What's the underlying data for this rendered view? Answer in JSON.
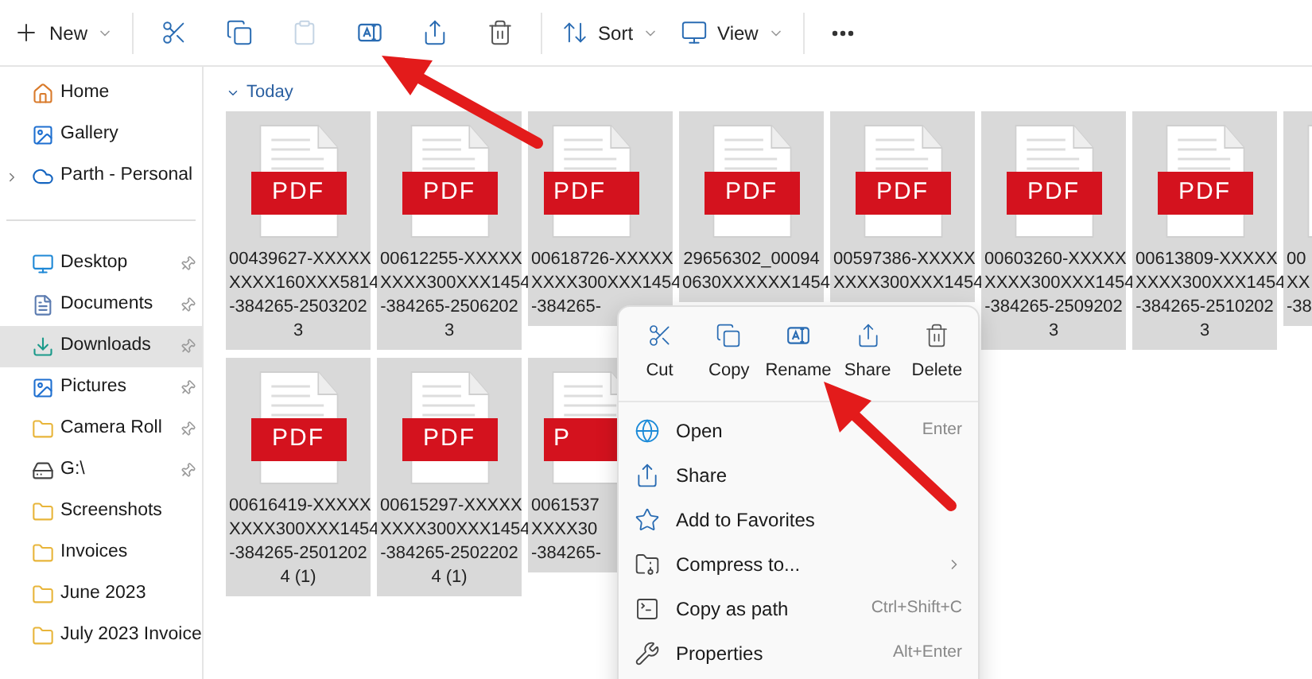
{
  "toolbar": {
    "groups": [
      [
        {
          "label": "New",
          "disabled": false
        }
      ],
      [
        {
          "disabled": false
        },
        {
          "disabled": false
        },
        {
          "disabled": true
        },
        {
          "disabled": false
        },
        {
          "disabled": false
        },
        {
          "disabled": false
        }
      ],
      [
        {
          "label": "Sort",
          "disabled": false
        },
        {
          "label": "View",
          "disabled": false
        }
      ],
      [
        {
          "disabled": false
        }
      ]
    ]
  },
  "sidebar": {
    "groups": [
      [
        {
          "label": "Home",
          "selected": false,
          "pinned": false
        },
        {
          "label": "Gallery",
          "selected": false,
          "pinned": false
        },
        {
          "label": "Parth - Personal",
          "selected": false,
          "pinned": false,
          "expanded": false
        }
      ],
      [
        {
          "label": "Desktop",
          "selected": false,
          "pinned": true
        },
        {
          "label": "Documents",
          "selected": false,
          "pinned": true
        },
        {
          "label": "Downloads",
          "selected": true,
          "pinned": true
        },
        {
          "label": "Pictures",
          "selected": false,
          "pinned": true
        },
        {
          "label": "Camera Roll",
          "selected": false,
          "pinned": true
        },
        {
          "label": "G:\\",
          "selected": false,
          "pinned": true
        },
        {
          "label": "Screenshots",
          "selected": false,
          "pinned": false
        },
        {
          "label": "Invoices",
          "selected": false,
          "pinned": false
        },
        {
          "label": "June 2023",
          "selected": false,
          "pinned": false
        },
        {
          "label": "July 2023 Invoice",
          "selected": false,
          "pinned": false
        }
      ]
    ]
  },
  "section": {
    "label": "Today",
    "expanded": true
  },
  "rows": [
    [
      {
        "badge": "PDF",
        "selected": true,
        "lines": [
          "00439627-XXXXX",
          "XXXX160XXX5814",
          "-384265-2503202",
          "3"
        ]
      },
      {
        "badge": "PDF",
        "selected": true,
        "lines": [
          "00612255-XXXXX",
          "XXXX300XXX1454",
          "-384265-2506202",
          "3"
        ]
      },
      {
        "badge": "PDF",
        "selected": true,
        "clipped": true,
        "lines": [
          "00618726-XXXXX",
          "XXXX300XXX1454",
          "-384265-"
        ]
      },
      {
        "badge": "PDF",
        "selected": true,
        "lines": [
          "29656302_00094",
          "0630XXXXXX1454"
        ]
      },
      {
        "badge": "PDF",
        "selected": true,
        "lines": [
          "00597386-XXXXX",
          "XXXX300XXX1454"
        ]
      },
      {
        "badge": "PDF",
        "selected": true,
        "lines": [
          "00603260-XXXXX",
          "XXXX300XXX1454",
          "-384265-2509202",
          "3"
        ]
      },
      {
        "badge": "PDF",
        "selected": true,
        "lines": [
          "00613809-XXXXX",
          "XXXX300XXX1454",
          "-384265-2510202",
          "3"
        ]
      },
      {
        "selected": true,
        "clipped": true,
        "lines": [
          "00",
          "XX",
          "-38"
        ]
      }
    ],
    [
      {
        "badge": "PDF",
        "selected": true,
        "lines": [
          "00616419-XXXXX",
          "XXXX300XXX1454",
          "-384265-2501202",
          "4 (1)"
        ]
      },
      {
        "badge": "PDF",
        "selected": true,
        "lines": [
          "00615297-XXXXX",
          "XXXX300XXX1454",
          "-384265-2502202",
          "4 (1)"
        ]
      },
      {
        "badge": "P",
        "selected": true,
        "clipped": true,
        "lines": [
          "0061537",
          "XXXX30",
          "-384265-"
        ]
      }
    ]
  ],
  "context_menu": {
    "actions": [
      {
        "label": "Cut"
      },
      {
        "label": "Copy"
      },
      {
        "label": "Rename"
      },
      {
        "label": "Share"
      },
      {
        "label": "Delete"
      }
    ],
    "items": [
      {
        "label": "Open",
        "shortcut": "Enter"
      },
      {
        "label": "Share"
      },
      {
        "label": "Add to Favorites"
      },
      {
        "label": "Compress to...",
        "submenu": true
      },
      {
        "label": "Copy as path",
        "shortcut": "Ctrl+Shift+C"
      },
      {
        "label": "Properties",
        "shortcut": "Alt+Enter"
      }
    ]
  }
}
